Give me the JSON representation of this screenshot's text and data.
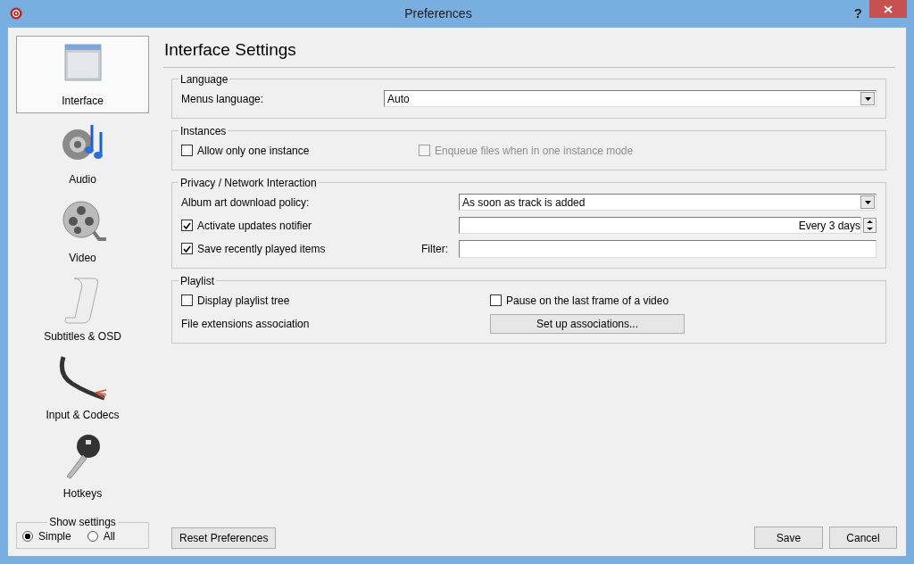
{
  "window": {
    "title": "Preferences",
    "help": "?"
  },
  "sidebar": {
    "items": [
      {
        "label": "Interface",
        "kind": "interface",
        "selected": true
      },
      {
        "label": "Audio",
        "kind": "audio",
        "selected": false
      },
      {
        "label": "Video",
        "kind": "video",
        "selected": false
      },
      {
        "label": "Subtitles & OSD",
        "kind": "subtitles",
        "selected": false
      },
      {
        "label": "Input & Codecs",
        "kind": "input",
        "selected": false
      },
      {
        "label": "Hotkeys",
        "kind": "hotkeys",
        "selected": false
      }
    ],
    "show_settings": {
      "title": "Show settings",
      "options": [
        {
          "label": "Simple",
          "selected": true
        },
        {
          "label": "All",
          "selected": false
        }
      ]
    }
  },
  "page_title": "Interface Settings",
  "groups": [
    {
      "title": "Language",
      "rows": [
        [
          {
            "kind": "label",
            "text": "Menus language:"
          },
          {
            "kind": "dropdown",
            "value": "Auto"
          }
        ]
      ]
    },
    {
      "title": "Instances",
      "rows": [
        [
          {
            "kind": "checkbox",
            "label": "Allow only one instance",
            "checked": false,
            "disabled": false
          },
          {
            "kind": "checkbox",
            "label": "Enqueue files when in one instance mode",
            "checked": false,
            "disabled": true
          }
        ]
      ]
    },
    {
      "title": "Privacy / Network Interaction",
      "rows": [
        [
          {
            "kind": "label",
            "text": "Album art download policy:"
          },
          {
            "kind": "dropdown",
            "value": "As soon as track is added"
          }
        ],
        [
          {
            "kind": "checkbox",
            "label": "Activate updates notifier",
            "checked": true,
            "disabled": false
          },
          {
            "kind": "spinbox",
            "value": "Every 3 days"
          }
        ],
        [
          {
            "kind": "checkbox",
            "label": "Save recently played items",
            "checked": true,
            "disabled": false
          },
          {
            "kind": "label",
            "text": "Filter:"
          },
          {
            "kind": "textfield"
          }
        ]
      ]
    },
    {
      "title": "Playlist",
      "rows": [
        [
          {
            "kind": "checkbox",
            "label": "Display playlist tree",
            "checked": false,
            "disabled": false
          },
          {
            "kind": "checkbox",
            "label": "Pause on the last frame of a video",
            "checked": false,
            "disabled": false
          }
        ],
        [
          {
            "kind": "label",
            "text": "File extensions association"
          },
          {
            "kind": "button",
            "text": "Set up associations..."
          }
        ]
      ]
    }
  ],
  "footer": {
    "reset": "Reset Preferences",
    "save": "Save",
    "cancel": "Cancel"
  }
}
